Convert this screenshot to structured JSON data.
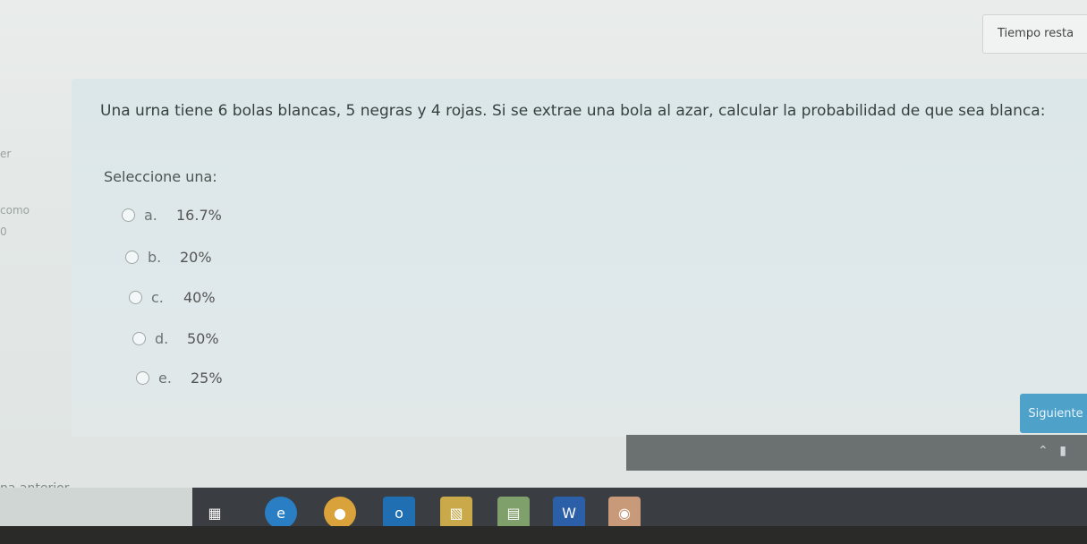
{
  "timer": {
    "label": "Tiempo resta"
  },
  "sidebar": {
    "fragments": [
      "er",
      "como",
      "0"
    ]
  },
  "question": {
    "text": "Una urna tiene 6 bolas blancas, 5 negras y 4 rojas. Si se extrae una bola al azar, calcular la probabilidad de que sea blanca:",
    "prompt": "Seleccione una:",
    "options": [
      {
        "letter": "a.",
        "value": "16.7%"
      },
      {
        "letter": "b.",
        "value": "20%"
      },
      {
        "letter": "c.",
        "value": "40%"
      },
      {
        "letter": "d.",
        "value": "50%"
      },
      {
        "letter": "e.",
        "value": "25%"
      }
    ]
  },
  "navigation": {
    "next_label": "Siguiente",
    "prev_label": "na anterior"
  },
  "taskbar": {
    "icons": [
      "task-view-icon",
      "edge-icon",
      "chrome-icon",
      "outlook-icon",
      "file-explorer-icon",
      "calendar-icon",
      "word-icon",
      "camera-icon"
    ],
    "tray": [
      "chevron-up-icon",
      "network-icon"
    ]
  }
}
